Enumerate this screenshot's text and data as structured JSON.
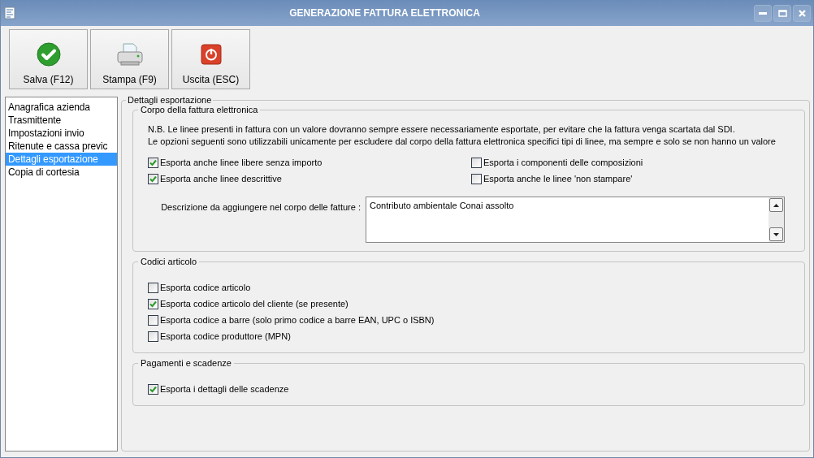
{
  "window": {
    "title": "GENERAZIONE FATTURA ELETTRONICA"
  },
  "toolbar": [
    {
      "label": "Salva (F12)",
      "kind": "save"
    },
    {
      "label": "Stampa (F9)",
      "kind": "print"
    },
    {
      "label": "Uscita (ESC)",
      "kind": "exit"
    }
  ],
  "sidebar": {
    "items": [
      {
        "label": "Anagrafica azienda",
        "selected": false
      },
      {
        "label": "Trasmittente",
        "selected": false
      },
      {
        "label": "Impostazioni invio",
        "selected": false
      },
      {
        "label": "Ritenute e cassa previc",
        "selected": false
      },
      {
        "label": "Dettagli esportazione",
        "selected": true
      },
      {
        "label": "Copia di cortesia",
        "selected": false
      }
    ]
  },
  "panel": {
    "title": "Dettagli esportazione",
    "groups": [
      {
        "title": "Corpo della fattura elettronica",
        "kind": "two-column",
        "notes": [
          "N.B. Le linee presenti in fattura con un valore dovranno sempre essere necessariamente esportate, per evitare che la fattura venga scartata dal SDI.",
          "Le opzioni seguenti sono utilizzabili unicamente per escludere dal corpo della fattura elettronica specifici tipi di linee, ma sempre e solo se non hanno un valore"
        ],
        "options": [
          {
            "label": "Esporta anche linee libere senza importo",
            "checked": true
          },
          {
            "label": "Esporta i componenti delle composizioni",
            "checked": false
          },
          {
            "label": "Esporta anche linee descrittive",
            "checked": true
          },
          {
            "label": "Esporta anche le linee 'non stampare'",
            "checked": false
          }
        ],
        "description": {
          "label": "Descrizione da aggiungere nel corpo delle fatture :",
          "value": "Contributo ambientale Conai assolto"
        }
      },
      {
        "title": "Codici articolo",
        "kind": "list",
        "options": [
          {
            "label": "Esporta codice articolo",
            "checked": false
          },
          {
            "label": "Esporta codice articolo del cliente (se presente)",
            "checked": true
          },
          {
            "label": "Esporta codice a barre (solo primo codice a barre EAN, UPC o ISBN)",
            "checked": false
          },
          {
            "label": "Esporta codice produttore (MPN)",
            "checked": false
          }
        ]
      },
      {
        "title": "Pagamenti e scadenze",
        "kind": "list",
        "options": [
          {
            "label": "Esporta i dettagli delle scadenze",
            "checked": true
          }
        ]
      }
    ]
  }
}
